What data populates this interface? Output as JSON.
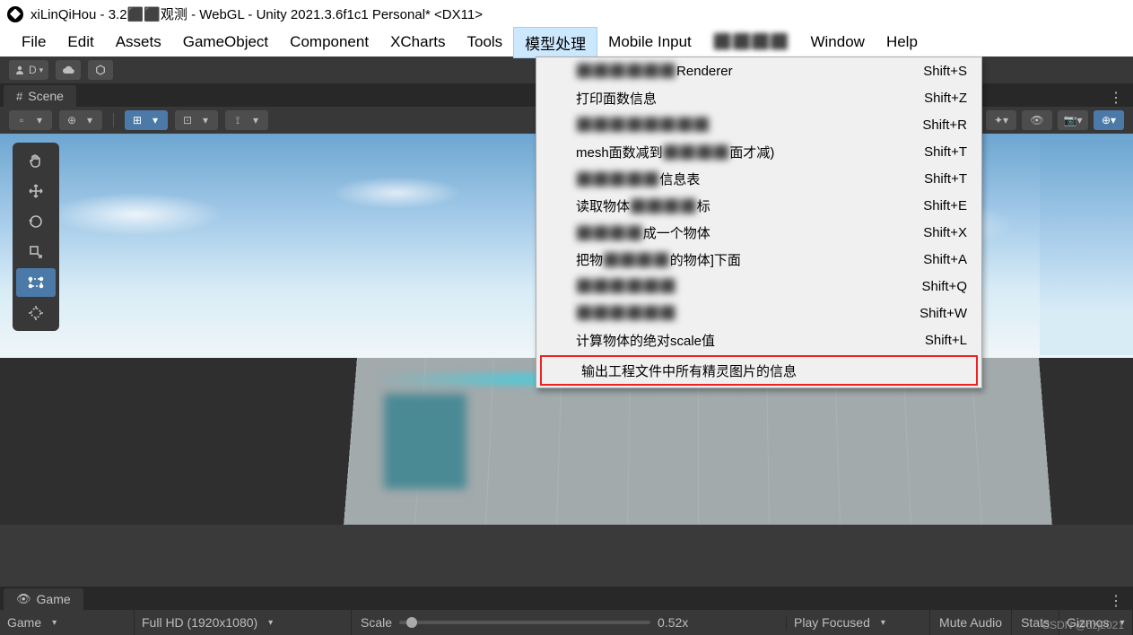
{
  "title": "xiLinQiHou - 3.2⬛⬛观测 - WebGL - Unity 2021.3.6f1c1 Personal* <DX11>",
  "menu": {
    "file": "File",
    "edit": "Edit",
    "assets": "Assets",
    "gameobject": "GameObject",
    "component": "Component",
    "xcharts": "XCharts",
    "tools": "Tools",
    "model": "模型处理",
    "mobile": "Mobile Input",
    "blur": "⬛⬛⬛⬛",
    "window": "Window",
    "help": "Help"
  },
  "account": "D",
  "scene_tab": "Scene",
  "dropdown": {
    "items": [
      {
        "label_pre": "",
        "label_blur": "⬛⬛⬛⬛⬛⬛",
        "label_post": "Renderer",
        "shortcut": "Shift+S"
      },
      {
        "label_pre": "打印面数信息",
        "label_blur": "",
        "label_post": "",
        "shortcut": "Shift+Z"
      },
      {
        "label_pre": "",
        "label_blur": "⬛⬛⬛⬛⬛⬛⬛⬛",
        "label_post": "",
        "shortcut": "Shift+R"
      },
      {
        "label_pre": "mesh面数减到",
        "label_blur": "⬛⬛⬛⬛",
        "label_post": "面才减)",
        "shortcut": "Shift+T"
      },
      {
        "label_pre": "",
        "label_blur": "⬛⬛⬛⬛⬛",
        "label_post": "信息表",
        "shortcut": "Shift+T"
      },
      {
        "label_pre": "读取物体",
        "label_blur": "⬛⬛⬛⬛",
        "label_post": "标",
        "shortcut": "Shift+E"
      },
      {
        "label_pre": "",
        "label_blur": "⬛⬛⬛⬛",
        "label_post": "成一个物体",
        "shortcut": "Shift+X"
      },
      {
        "label_pre": "把物",
        "label_blur": "⬛⬛⬛⬛",
        "label_post": "的物体]下面",
        "shortcut": "Shift+A"
      },
      {
        "label_pre": "",
        "label_blur": "⬛⬛⬛⬛⬛⬛",
        "label_post": "",
        "shortcut": "Shift+Q"
      },
      {
        "label_pre": "",
        "label_blur": "⬛⬛⬛⬛⬛⬛",
        "label_post": "",
        "shortcut": "Shift+W"
      },
      {
        "label_pre": "计算物体的绝对scale值",
        "label_blur": "",
        "label_post": "",
        "shortcut": "Shift+L"
      },
      {
        "label_pre": "输出工程文件中所有精灵图片的信息",
        "label_blur": "",
        "label_post": "",
        "shortcut": ""
      }
    ]
  },
  "game_tab": "Game",
  "footer": {
    "display": "Game",
    "resolution": "Full HD (1920x1080)",
    "scale_label": "Scale",
    "scale_value": "0.52x",
    "play": "Play Focused",
    "mute": "Mute Audio",
    "stats": "Stats",
    "gizmos": "Gizmos"
  },
  "watermark": "CSDN @dzj2021"
}
